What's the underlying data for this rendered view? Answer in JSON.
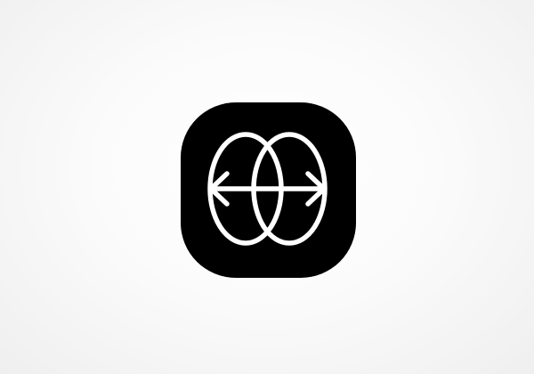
{
  "app_icon": {
    "icon_name": "reface-logo-icon",
    "background_color": "#000000",
    "glyph_color": "#ffffff"
  },
  "page": {
    "background_color": "#f7f7f7"
  }
}
